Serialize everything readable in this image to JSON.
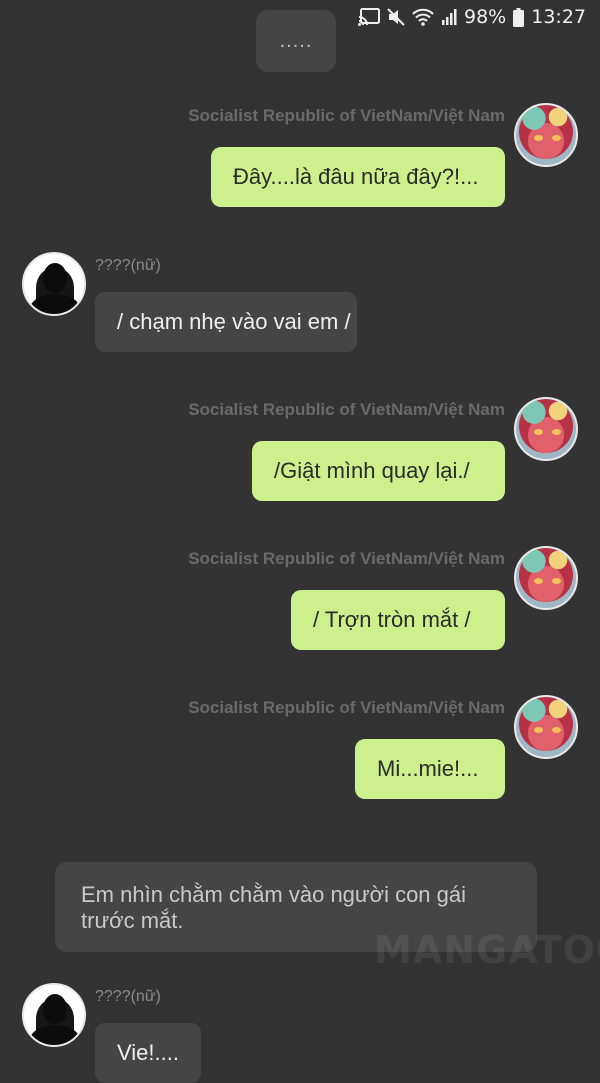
{
  "status_bar": {
    "battery": "98%",
    "time": "13:27",
    "icons": [
      "cast-icon",
      "mute-icon",
      "wifi-icon",
      "signal-icon",
      "battery-icon"
    ]
  },
  "narrations": [
    {
      "text": "....."
    },
    {
      "text": "Em nhìn chằm chằm vào người con gái trước mắt."
    }
  ],
  "watermark": "MANGATOON",
  "messages": [
    {
      "side": "right",
      "sender": "Socialist Republic of VietNam/Việt  Nam",
      "text": "Đây....là đâu nữa đây?!..."
    },
    {
      "side": "left",
      "sender": "????(nữ)",
      "text": "/ chạm nhẹ vào vai em /"
    },
    {
      "side": "right",
      "sender": "Socialist Republic of VietNam/Việt  Nam",
      "text": "/Giật mình quay lại./"
    },
    {
      "side": "right",
      "sender": "Socialist Republic of VietNam/Việt  Nam",
      "text": "/ Trợn tròn mắt /"
    },
    {
      "side": "right",
      "sender": "Socialist Republic of VietNam/Việt  Nam",
      "text": "Mi...mie!..."
    },
    {
      "side": "left",
      "sender": "????(nữ)",
      "text": "Vie!...."
    }
  ],
  "colors": {
    "background": "#333333",
    "my_bubble": "#ccf08b",
    "their_bubble": "#454545"
  }
}
